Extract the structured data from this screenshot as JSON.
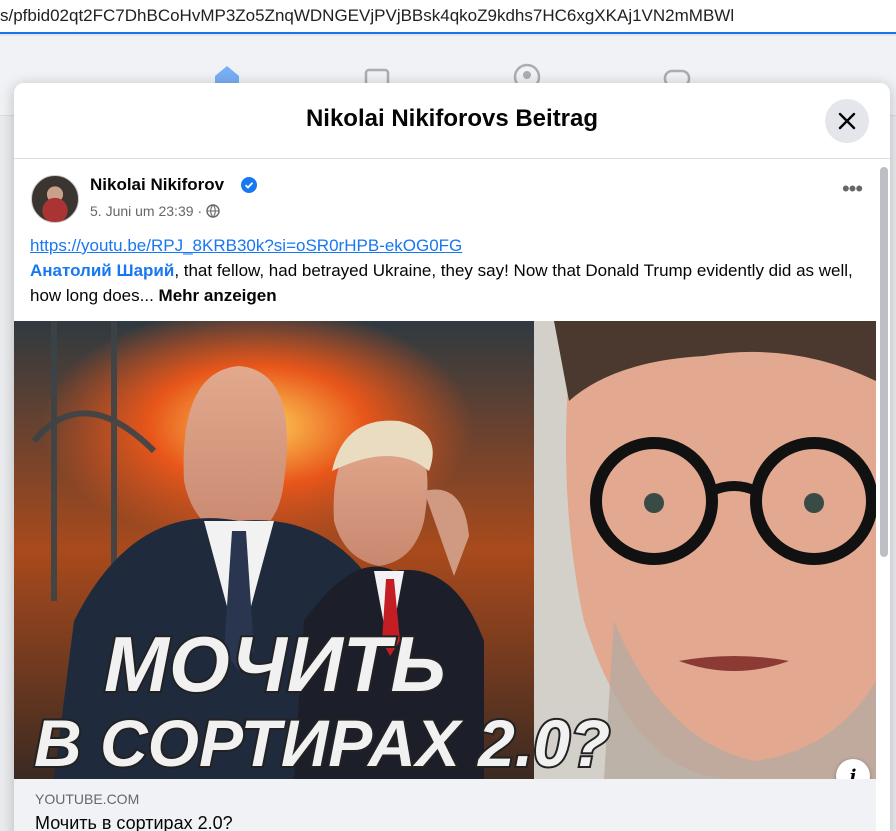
{
  "browser": {
    "url": "s/pfbid02qt2FC7DhBCoHvMP3Zo5ZnqWDNGEVjPVjBBsk4qkoZ9kdhs7HC6xgXKAj1VN2mMBWl"
  },
  "modal": {
    "title": "Nikolai Nikiforovs Beitrag"
  },
  "post": {
    "author": "Nikolai Nikiforov",
    "timestamp": "5. Juni um 23:39",
    "separator": "·",
    "link_url": "https://youtu.be/RPJ_8KRB30k?si=oSR0rHPB-ekOG0FG",
    "mention": "Анатолий Шарий",
    "text": ", that fellow, had betrayed Ukraine, they say! Now that Donald Trump evidently did as well, how long does...",
    "see_more": "Mehr anzeigen"
  },
  "thumbnail": {
    "line1": "МОЧИТЬ",
    "line2": "В СОРТИРАХ 2.0?"
  },
  "link_preview": {
    "domain": "YOUTUBE.COM",
    "title": "Мочить в сортирах 2.0?"
  },
  "colors": {
    "accent": "#1877f2",
    "url_underline": "#1a73e8"
  },
  "icons": [
    "home-icon",
    "marketplace-icon",
    "groups-icon",
    "gaming-icon",
    "close-icon",
    "verified-icon",
    "globe-icon",
    "more-options-icon",
    "info-icon"
  ]
}
